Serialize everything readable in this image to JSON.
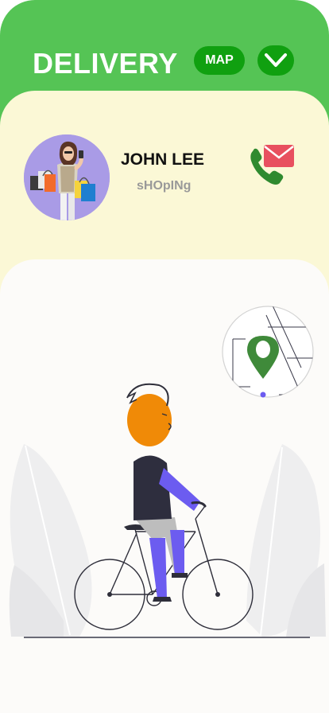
{
  "header": {
    "title": "DELIVERY",
    "map_label": "MAP"
  },
  "profile": {
    "name": "JOHN LEE",
    "role": "sHOpINg"
  },
  "icons": {
    "chevron": "chevron-down-icon",
    "contact": "phone-mail-icon",
    "map": "map-pin-icon"
  },
  "colors": {
    "header_green": "#55c455",
    "button_green": "#10a010",
    "profile_bg": "#fbf8d6",
    "pin_green": "#3f8a3a",
    "rider_orange": "#f08a07",
    "rider_purple": "#6c5cf0"
  }
}
